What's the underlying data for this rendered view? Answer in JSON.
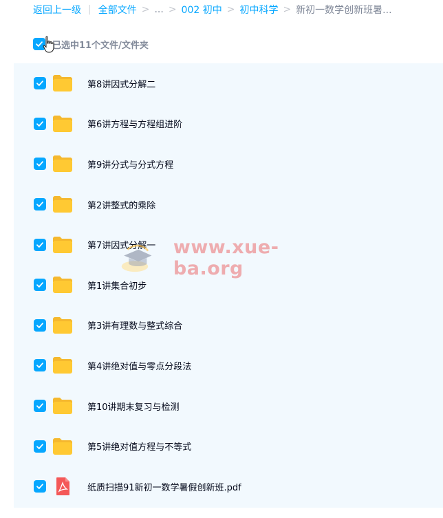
{
  "breadcrumb": {
    "back_label": "返回上一级",
    "all_files_label": "全部文件",
    "ellipsis_label": "...",
    "crumb_1": "002 初中",
    "crumb_2": "初中科学",
    "current": "新初一数学创新班暑..."
  },
  "selection": {
    "summary": "已选中11个文件/文件夹"
  },
  "files": [
    {
      "name": "第8讲因式分解二",
      "type": "folder"
    },
    {
      "name": "第6讲方程与方程组进阶",
      "type": "folder"
    },
    {
      "name": "第9讲分式与分式方程",
      "type": "folder"
    },
    {
      "name": "第2讲整式的乘除",
      "type": "folder"
    },
    {
      "name": "第7讲因式分解一",
      "type": "folder"
    },
    {
      "name": "第1讲集合初步",
      "type": "folder"
    },
    {
      "name": "第3讲有理数与整式综合",
      "type": "folder"
    },
    {
      "name": "第4讲绝对值与零点分段法",
      "type": "folder"
    },
    {
      "name": "第10讲期末复习与检测",
      "type": "folder"
    },
    {
      "name": "第5讲绝对值方程与不等式",
      "type": "folder"
    },
    {
      "name": "纸质扫描91新初一数学暑假创新班.pdf",
      "type": "pdf"
    }
  ],
  "watermark": {
    "text": "www.xue-ba.org"
  },
  "colors": {
    "accent": "#06a7ff",
    "list_background": "#f2f9fe",
    "folder": "#ffc933",
    "pdf": "#f45858"
  },
  "icons": {
    "folder": "folder-icon",
    "pdf": "pdf-icon",
    "checkbox": "checkbox-checked-icon",
    "cursor": "hand-pointer-icon"
  }
}
